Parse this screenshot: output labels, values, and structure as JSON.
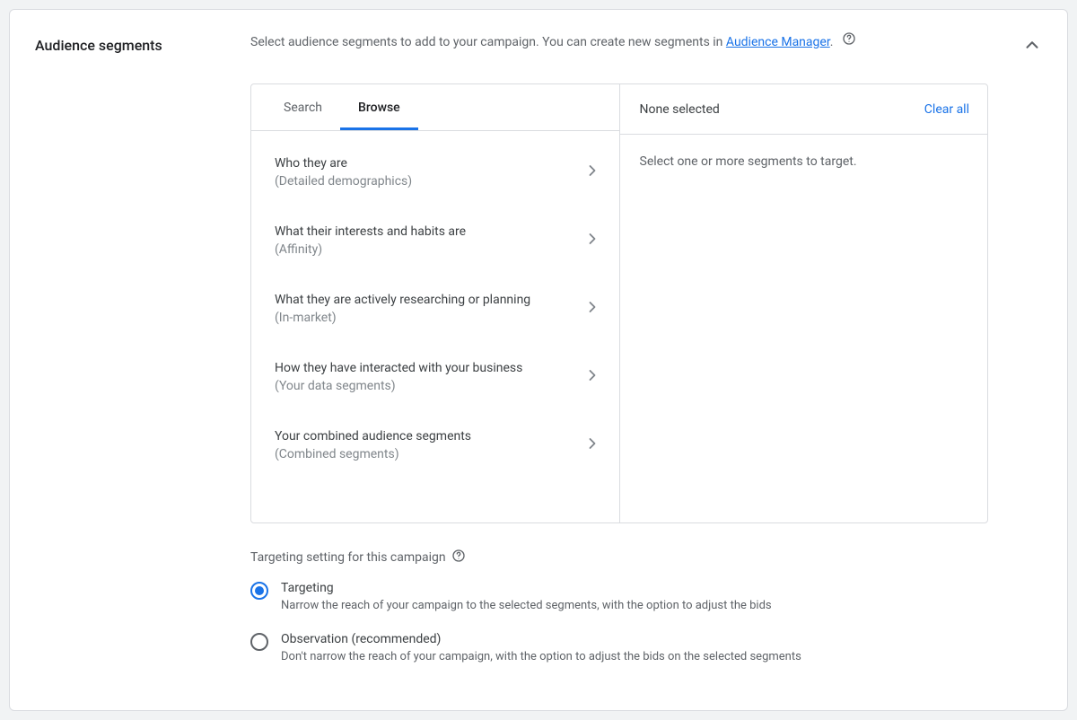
{
  "title": "Audience segments",
  "intro": {
    "prefix": "Select audience segments to add to your campaign. You can create new segments in ",
    "link_text": "Audience Manager",
    "suffix": "."
  },
  "tabs": {
    "search": "Search",
    "browse": "Browse"
  },
  "categories": [
    {
      "title": "Who they are",
      "sub": "(Detailed demographics)"
    },
    {
      "title": "What their interests and habits are",
      "sub": "(Affinity)"
    },
    {
      "title": "What they are actively researching or planning",
      "sub": "(In-market)"
    },
    {
      "title": "How they have interacted with your business",
      "sub": "(Your data segments)"
    },
    {
      "title": "Your combined audience segments",
      "sub": "(Combined segments)"
    }
  ],
  "selected": {
    "header": "None selected",
    "clear_all": "Clear all",
    "empty_text": "Select one or more segments to target."
  },
  "targeting": {
    "label": "Targeting setting for this campaign",
    "options": [
      {
        "title": "Targeting",
        "desc": "Narrow the reach of your campaign to the selected segments, with the option to adjust the bids",
        "selected": true
      },
      {
        "title": "Observation (recommended)",
        "desc": "Don't narrow the reach of your campaign, with the option to adjust the bids on the selected segments",
        "selected": false
      }
    ]
  }
}
